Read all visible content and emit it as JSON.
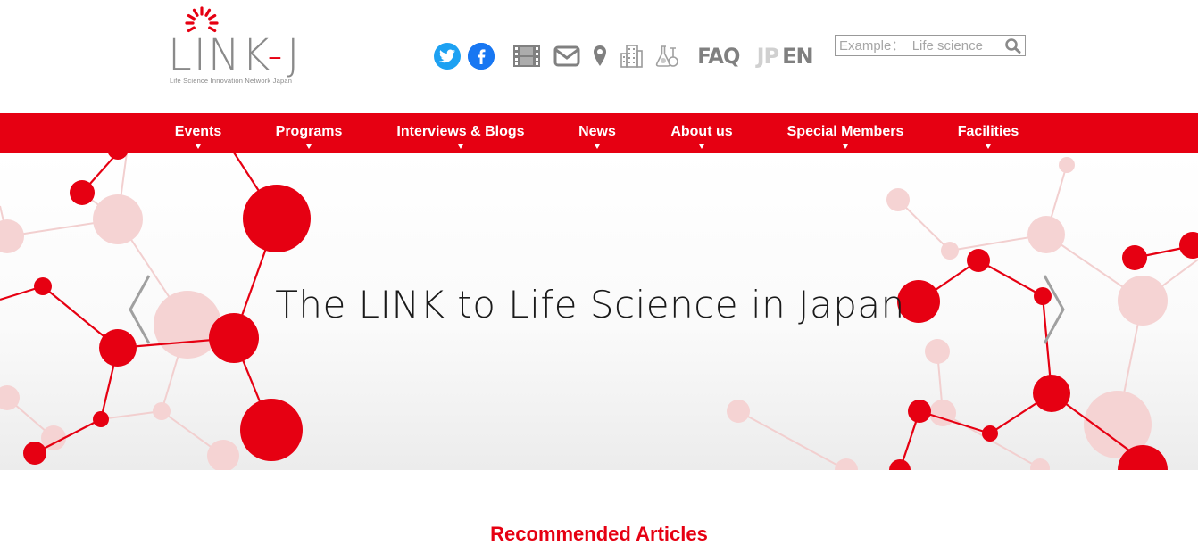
{
  "logo": {
    "text": "LINK",
    "dash": "-",
    "letter": "J",
    "tagline": "Life Science Innovation Network Japan"
  },
  "header_icons": [
    "twitter-icon",
    "facebook-icon",
    "video-icon",
    "mail-icon",
    "map-pin-icon",
    "building-icon",
    "lab-flask-icon"
  ],
  "header": {
    "faq": "FAQ",
    "lang_jp": "JP",
    "lang_en": "EN"
  },
  "search": {
    "placeholder": "Example：  Life science",
    "value": ""
  },
  "nav": [
    {
      "label": "Events"
    },
    {
      "label": "Programs"
    },
    {
      "label": "Interviews & Blogs"
    },
    {
      "label": "News"
    },
    {
      "label": "About us"
    },
    {
      "label": "Special Members"
    },
    {
      "label": "Facilities"
    }
  ],
  "hero": {
    "tagline": "The LINK to Life Science in Japan"
  },
  "recommended": {
    "title": "Recommended Articles"
  },
  "colors": {
    "brand_red": "#e60012",
    "pale_red": "#f4d0d0",
    "icon_gray": "#808080",
    "twitter": "#1da1f2",
    "facebook": "#1877f2"
  }
}
